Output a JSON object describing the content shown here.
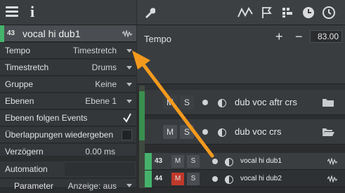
{
  "inspector": {
    "track_number": "43",
    "track_name": "vocal hi dub1",
    "rows": [
      {
        "label": "Tempo",
        "value": "Timestretch",
        "dropdown": true
      },
      {
        "label": "Timestretch",
        "value": "Drums",
        "dropdown": true
      },
      {
        "label": "Gruppe",
        "value": "Keine",
        "dropdown": true
      },
      {
        "label": "Ebenen",
        "value": "Ebene 1",
        "dropdown": true
      },
      {
        "label": "Ebenen folgen Events",
        "value": "",
        "checked": true
      },
      {
        "label": "Überlappungen wiedergeben",
        "value": "",
        "checked": false
      },
      {
        "label": "Verzögern",
        "value": "0.00 ms",
        "dropdown": false
      }
    ],
    "automation_label": "Automation",
    "parameter_label": "Parameter",
    "parameter_value": "Anzeige: aus"
  },
  "tempo": {
    "label": "Tempo",
    "plus": "+",
    "minus": "−",
    "value": "83.00"
  },
  "tracks": [
    {
      "m": "M",
      "s": "S",
      "name": "dub voc aftr crs"
    },
    {
      "m": "M",
      "s": "S",
      "name": "dub voc crs"
    }
  ],
  "small_tracks": [
    {
      "num": "43",
      "m": "M",
      "s": "S",
      "name": "vocal hi dub1"
    },
    {
      "num": "44",
      "m": "M",
      "s": "S",
      "name": "vocal hi dub2"
    }
  ],
  "colors": {
    "track_green": "#45b36b",
    "arrow_orange": "#f39a1e",
    "mute_red": "#c0392b"
  }
}
